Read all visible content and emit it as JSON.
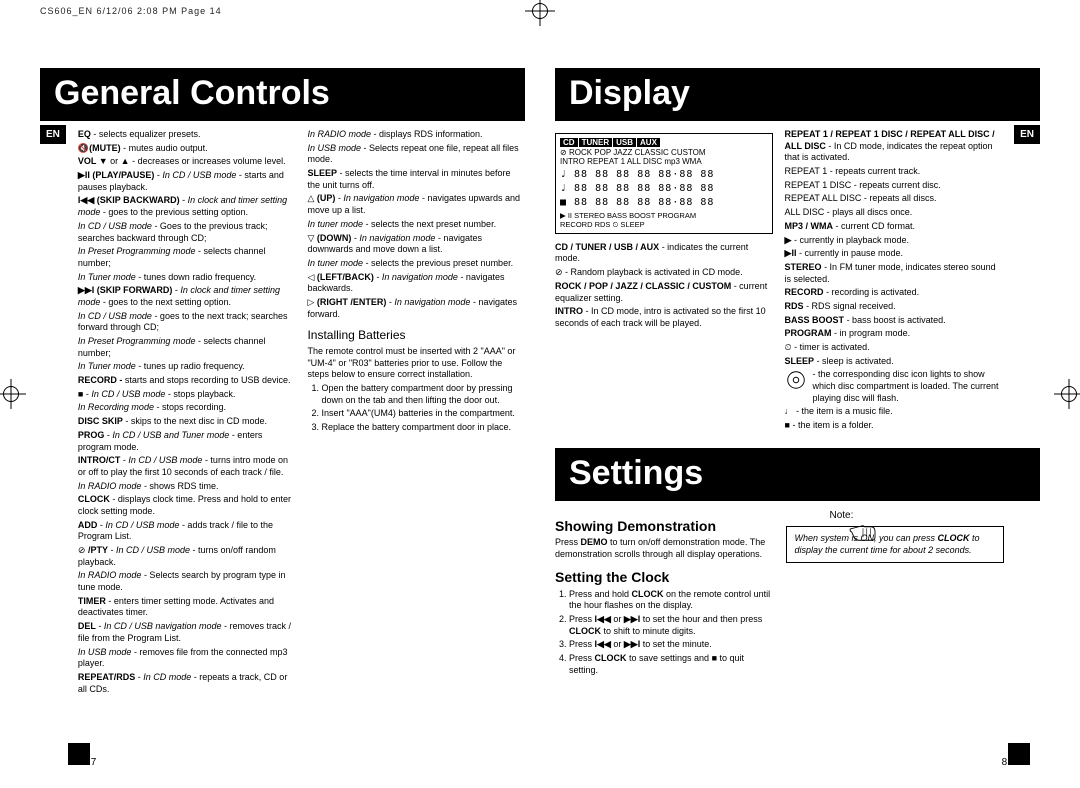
{
  "header": "CS606_EN  6/12/06  2:08 PM  Page 14",
  "titles": {
    "general": "General Controls",
    "display": "Display",
    "settings": "Settings"
  },
  "lang": "EN",
  "page_left": "7",
  "page_right": "8",
  "gc_col1": {
    "eq": "EQ - selects equalizer presets.",
    "mute": "(MUTE) - mutes audio output.",
    "vol": "VOL ▼ or ▲  - decreases or increases volume level.",
    "play": "▶II (PLAY/PAUSE) - In CD / USB mode - starts and pauses playback.",
    "skipb1": "I◀◀ (SKIP BACKWARD) - In clock and timer setting mode - goes to the previous setting option.",
    "skipb2": "In CD / USB mode - Goes to the previous track; searches backward through CD;",
    "skipb3": "In Preset Programming mode - selects channel number;",
    "skipb4": "In Tuner mode - tunes down radio frequency.",
    "skipf1": "▶▶I (SKIP FORWARD) - In clock and timer setting mode - goes to the next setting option.",
    "skipf2": "In CD / USB mode - goes to the next track; searches forward through CD;",
    "skipf3": "In Preset Programming mode - selects channel number;",
    "skipf4": "In Tuner mode - tunes up radio frequency.",
    "record": "RECORD - starts and stops recording to USB device.",
    "stop1": "■  - In CD / USB mode - stops playback.",
    "stop2": "In Recording mode - stops recording.",
    "discskip": "DISC SKIP - skips to the next disc in CD mode.",
    "prog": "PROG - In CD / USB and Tuner mode - enters program mode.",
    "intro": "INTRO/CT - In CD / USB mode - turns intro mode on or off to play the first 10 seconds of each track / file.",
    "intro2": "In RADIO mode - shows RDS time.",
    "clock": "CLOCK - displays clock time. Press and hold to enter clock setting mode.",
    "add": "ADD  - In CD / USB mode  - adds track / file to the Program List.",
    "pty": "⊘ /PTY - In CD / USB mode - turns on/off random playback.",
    "pty2": "In RADIO mode - Selects search  by program type in tune mode.",
    "timer": "TIMER - enters timer setting mode. Activates and deactivates timer.",
    "del": "DEL  - In CD / USB navigation mode - removes track / file from the Program List.",
    "del2": "In USB mode - removes file from the connected mp3 player.",
    "repeat": "REPEAT/RDS - In CD mode - repeats a track, CD or all CDs."
  },
  "gc_col2": {
    "radio": "In RADIO mode - displays RDS information.",
    "usb": "In USB mode - Selects repeat one file, repeat all files mode.",
    "sleep": "SLEEP - selects the time interval in minutes before the unit turns off.",
    "up": "△ (UP)  -  In navigation mode - navigates upwards and move up a list.",
    "up2": "In tuner mode - selects the next preset number.",
    "down": "▽ (DOWN) - In navigation mode - navigates downwards and move down a list.",
    "down2": "In tuner mode - selects the previous preset number.",
    "left": "◁ (LEFT/BACK) - In navigation mode - navigates backwards.",
    "right": "▷ (RIGHT /ENTER) - In navigation mode - navigates forward.",
    "install_h": "Installing Batteries",
    "install_p": "The remote control must be inserted with 2 \"AAA\" or \"UM-4\" or \"R03\" batteries prior to use. Follow the steps below to ensure correct installation.",
    "step1": "Open the battery compartment door by pressing down on the tab and then lifting the door out.",
    "step2": "Insert \"AAA\"(UM4) batteries in the compartment.",
    "step3": "Replace the battery compartment door in place."
  },
  "display": {
    "row1": "ROCK  POP   JAZZ  CLASSIC  CUSTOM",
    "row2": "INTRO  REPEAT  1 ALL   DISC  mp3 WMA",
    "tabs": {
      "cd": "CD",
      "tuner": "TUNER",
      "usb": "USB",
      "aux": "AUX"
    },
    "bottom": "▶ II STEREO        BASS BOOST      PROGRAM",
    "bottom2": "RECORD  RDS                                  ⏲  SLEEP",
    "p1": "CD / TUNER / USB / AUX - indicates the current mode.",
    "p2": "⊘ - Random playback is activated in CD mode.",
    "p3": "ROCK / POP / JAZZ / CLASSIC / CUSTOM - current equalizer setting.",
    "p4": "INTRO - In CD mode, intro is activated so the first 10 seconds of each track will be played.",
    "r1": "REPEAT 1 / REPEAT 1 DISC / REPEAT ALL DISC / ALL DISC - In CD mode, indicates the repeat option that is activated.",
    "r2": "REPEAT 1 - repeats current track.",
    "r3": "REPEAT 1 DISC - repeats current disc.",
    "r4": "REPEAT ALL DISC - repeats all discs.",
    "r5": "ALL DISC - plays all discs once.",
    "r6": "MP3 / WMA - current CD format.",
    "r7": "▶ - currently in playback mode.",
    "r8": "▶II - currently in pause mode.",
    "r9": "STEREO - In FM tuner mode, indicates stereo sound is selected.",
    "r10": "RECORD - recording is activated.",
    "r11": "RDS - RDS signal received.",
    "r12": "BASS BOOST - bass boost is activated.",
    "r13": "PROGRAM - in program mode.",
    "r14": "⏲ - timer is activated.",
    "r15": "SLEEP - sleep is activated.",
    "r16": "- the corresponding disc icon lights to show which disc compartment is loaded. The current playing disc will flash.",
    "r17": "♩ - the item is a music file.",
    "r18": "■ - the item is a folder."
  },
  "settings": {
    "demo_h": "Showing Demonstration",
    "demo_p": "Press DEMO to turn on/off demonstration mode. The demonstration scrolls through all display operations.",
    "clock_h": "Setting the Clock",
    "c1": "Press and hold CLOCK on the remote control until the hour flashes on the display.",
    "c2": "Press I◀◀ or ▶▶I to set the hour and then press CLOCK to shift to minute digits.",
    "c3": "Press I◀◀ or ▶▶I to set the minute.",
    "c4": "Press CLOCK  to save settings and ■ to quit setting.",
    "note_h": "Note:",
    "note_p": "When system is ON, you can press CLOCK to display the current time for about 2 seconds."
  }
}
